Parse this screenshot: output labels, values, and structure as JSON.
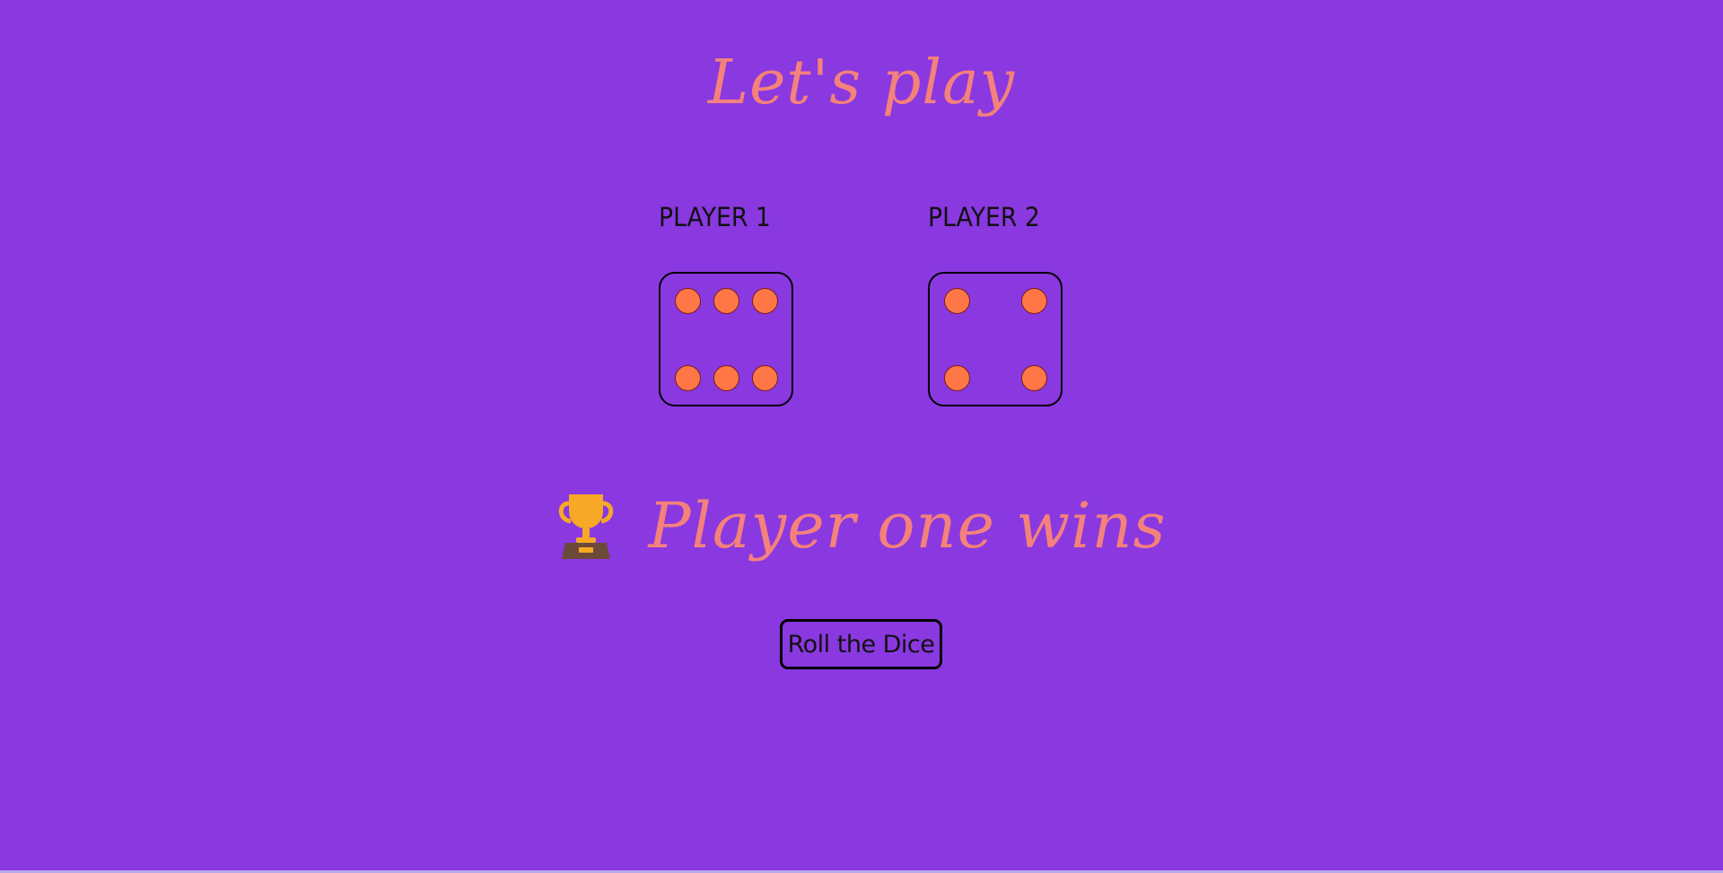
{
  "title": "Let's play",
  "players": [
    {
      "label": "PLAYER 1",
      "die_value": 6
    },
    {
      "label": "PLAYER 2",
      "die_value": 4
    }
  ],
  "result": {
    "icon": "trophy-icon",
    "text": "Player one wins"
  },
  "roll_button_label": "Roll the Dice",
  "colors": {
    "background": "#8a38e0",
    "accent_text": "#f4817b",
    "pip_fill": "#ff7747",
    "pip_border": "#7a1e1e",
    "trophy_gold": "#f6a826",
    "trophy_base": "#6b4a3a"
  }
}
